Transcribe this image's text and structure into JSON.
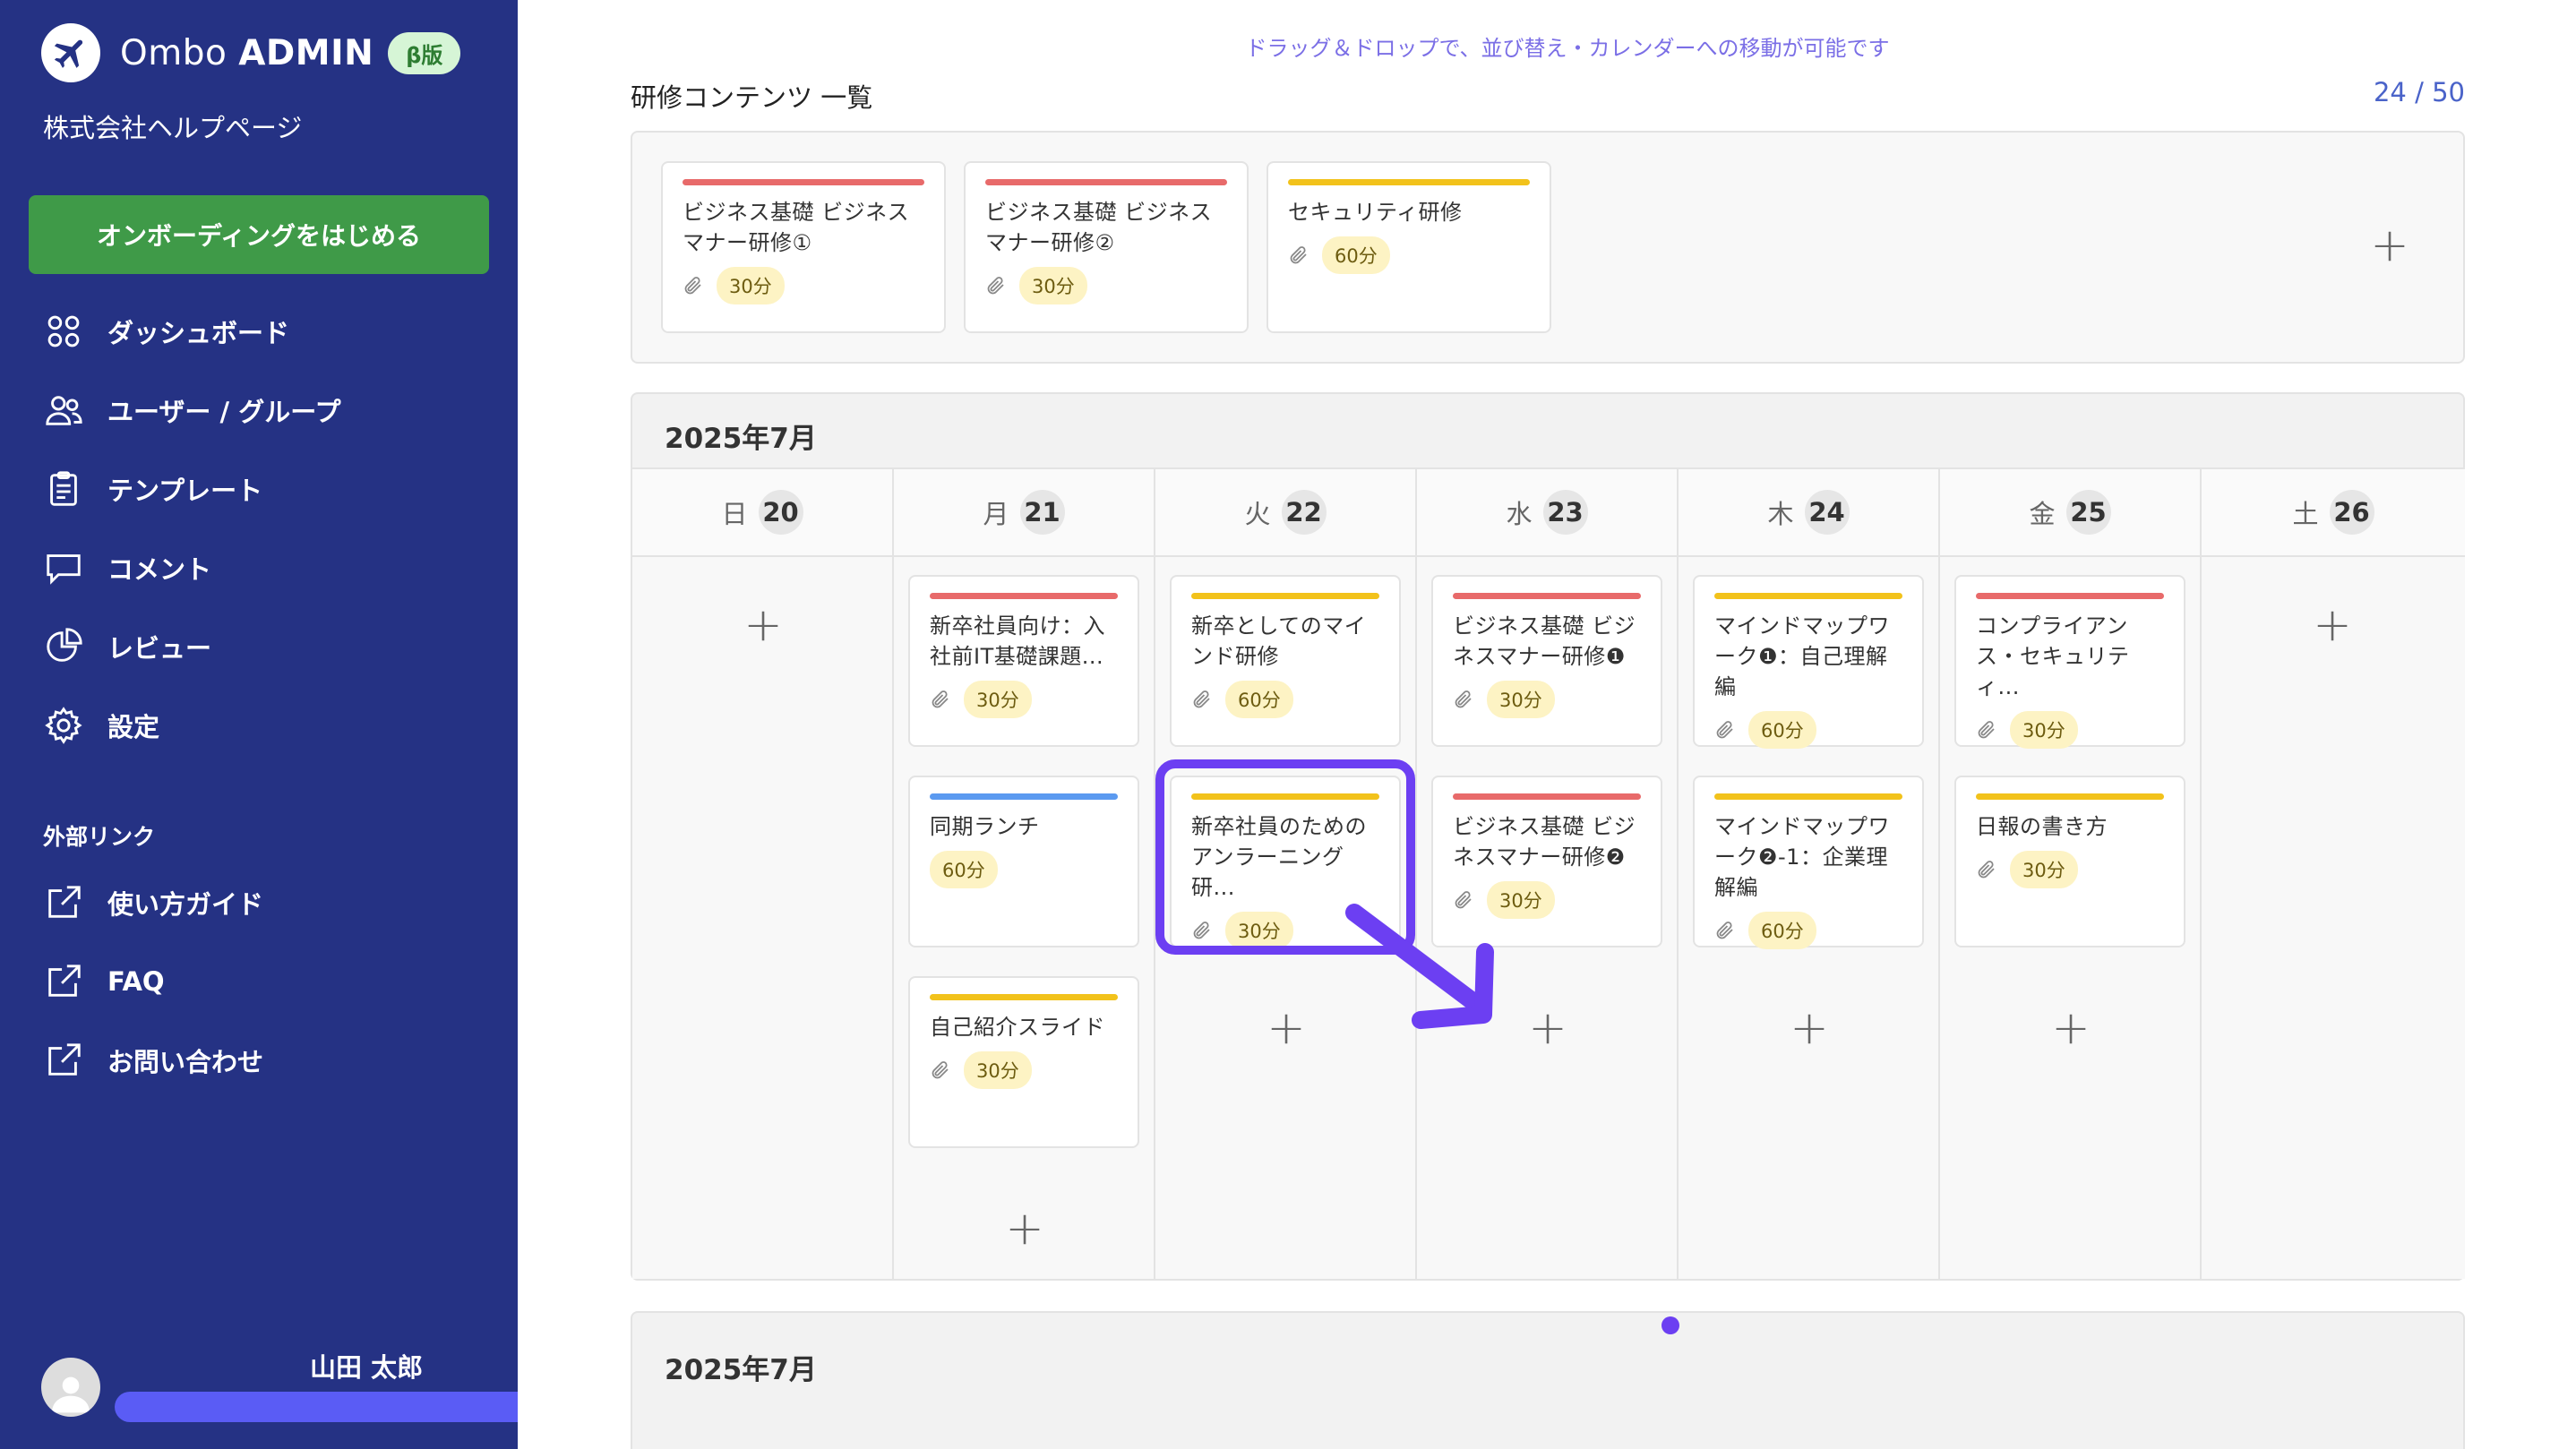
{
  "sidebar": {
    "brand_light": "Ombo",
    "brand_bold": "ADMIN",
    "beta_badge": "β版",
    "company": "株式会社ヘルプページ",
    "onboarding_button": "オンボーディングをはじめる",
    "nav": [
      {
        "label": "ダッシュボード",
        "icon": "grid-icon"
      },
      {
        "label": "ユーザー / グループ",
        "icon": "users-icon"
      },
      {
        "label": "テンプレート",
        "icon": "clipboard-icon"
      },
      {
        "label": "コメント",
        "icon": "chat-bubble-icon"
      },
      {
        "label": "レビュー",
        "icon": "pie-chart-icon"
      },
      {
        "label": "設定",
        "icon": "gear-icon"
      }
    ],
    "external_label": "外部リンク",
    "external": [
      {
        "label": "使い方ガイド",
        "icon": "external-link-icon"
      },
      {
        "label": "FAQ",
        "icon": "external-link-icon"
      },
      {
        "label": "お問い合わせ",
        "icon": "external-link-icon"
      }
    ],
    "user_name": "山田 太郎"
  },
  "main": {
    "hint": "ドラッグ＆ドロップで、並び替え・カレンダーへの移動が可能です",
    "list_title": "研修コンテンツ 一覧",
    "counter": "24 / 50",
    "contents": [
      {
        "title": "ビジネス基礎 ビジネスマナー研修①",
        "duration": "30分",
        "color": "#e86a6a"
      },
      {
        "title": "ビジネス基礎 ビジネスマナー研修②",
        "duration": "30分",
        "color": "#e86a6a"
      },
      {
        "title": "セキュリティ研修",
        "duration": "60分",
        "color": "#f2c21b"
      }
    ],
    "calendar_title": "2025年7月",
    "calendar_title_next": "2025年7月",
    "days": [
      {
        "dow": "日",
        "num": "20"
      },
      {
        "dow": "月",
        "num": "21"
      },
      {
        "dow": "火",
        "num": "22"
      },
      {
        "dow": "水",
        "num": "23"
      },
      {
        "dow": "木",
        "num": "24"
      },
      {
        "dow": "金",
        "num": "25"
      },
      {
        "dow": "土",
        "num": "26"
      }
    ],
    "events": {
      "mon": [
        {
          "title": "新卒社員向け：入社前IT基礎課題...",
          "duration": "30分",
          "color": "#e86a6a"
        },
        {
          "title": "同期ランチ",
          "duration": "60分",
          "color": "#5b9af0"
        },
        {
          "title": "自己紹介スライド",
          "duration": "30分",
          "color": "#f2c21b"
        }
      ],
      "tue": [
        {
          "title": "新卒としてのマインド研修",
          "duration": "60分",
          "color": "#f2c21b"
        },
        {
          "title": "新卒社員のためのアンラーニング研...",
          "duration": "30分",
          "color": "#f2c21b"
        }
      ],
      "wed": [
        {
          "title": "ビジネス基礎 ビジネスマナー研修❶",
          "duration": "30分",
          "color": "#e86a6a"
        },
        {
          "title": "ビジネス基礎 ビジネスマナー研修❷",
          "duration": "30分",
          "color": "#e86a6a"
        }
      ],
      "thu": [
        {
          "title": "マインドマップワーク❶：自己理解編",
          "duration": "60分",
          "color": "#f2c21b"
        },
        {
          "title": "マインドマップワーク❷-1：企業理解編",
          "duration": "60分",
          "color": "#f2c21b"
        }
      ],
      "fri": [
        {
          "title": "コンプライアンス・セキュリティ...",
          "duration": "30分",
          "color": "#e86a6a"
        },
        {
          "title": "日報の書き方",
          "duration": "30分",
          "color": "#f2c21b"
        }
      ]
    }
  }
}
